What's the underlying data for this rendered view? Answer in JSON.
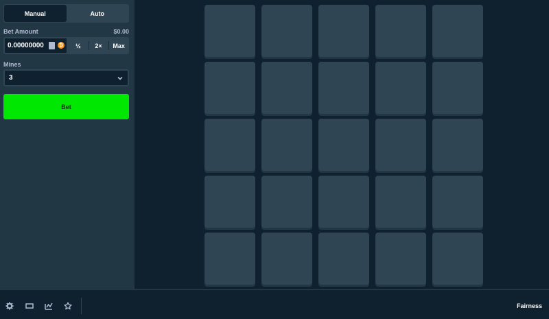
{
  "mode_tabs": {
    "manual": "Manual",
    "auto": "Auto",
    "active": "manual"
  },
  "bet_amount": {
    "label": "Bet Amount",
    "usd_value": "$0.00",
    "value": "0.00000000",
    "currency_icon": "bitcoin-icon",
    "half_label": "½",
    "double_label": "2×",
    "max_label": "Max"
  },
  "mines": {
    "label": "Mines",
    "selected": "3"
  },
  "bet_button": {
    "label": "Bet"
  },
  "board": {
    "rows": 5,
    "cols": 5,
    "tile_count": 25
  },
  "footer": {
    "icons": [
      "settings-icon",
      "theater-mode-icon",
      "stats-icon",
      "favorite-star-icon"
    ],
    "fairness_label": "Fairness"
  },
  "colors": {
    "background": "#0f212e",
    "sidebar": "#213743",
    "tile": "#2f4553",
    "bet_button": "#00e701",
    "text": "#b1bad3"
  }
}
